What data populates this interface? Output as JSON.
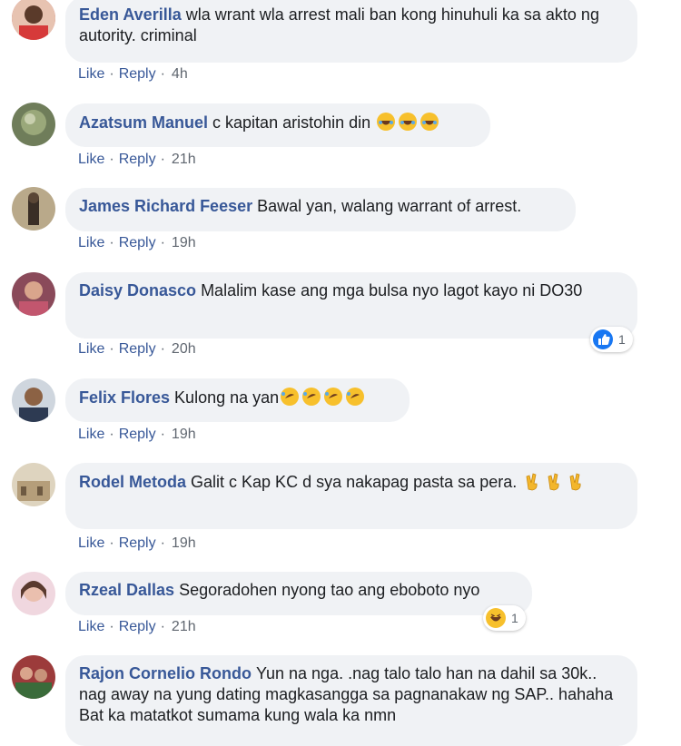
{
  "comments": [
    {
      "author": "Eden Averilla",
      "text": "wla wrant wla arrest mali ban kong hinuhuli ka sa akto ng autority. criminal",
      "suffix": "",
      "time": "4h"
    },
    {
      "author": "Azatsum Manuel",
      "text": "c kapitan aristohin din",
      "suffix": "",
      "time": "21h"
    },
    {
      "author": "James Richard Feeser",
      "text": "Bawal yan, walang warrant of arrest.",
      "suffix": "",
      "time": "19h"
    },
    {
      "author": "Daisy Donasco",
      "text": "Malalim kase ang mga bulsa nyo lagot kayo ni DO30",
      "suffix": "",
      "time": "20h",
      "reaction_count": "1"
    },
    {
      "author": "Felix Flores",
      "text": "Kulong na yan",
      "suffix": "",
      "time": "19h"
    },
    {
      "author": "Rodel Metoda",
      "text": "Galit c Kap KC d sya nakapag pasta sa pera.",
      "suffix": "",
      "time": "19h"
    },
    {
      "author": "Rzeal Dallas",
      "text": "Segoradohen nyong tao ang eboboto nyo",
      "suffix": "",
      "time": "21h",
      "reaction_count": "1"
    },
    {
      "author": "Rajon Cornelio Rondo",
      "text": "Yun na nga. .nag talo talo han na dahil sa 30k.. nag away na yung dating magkasangga sa pagnanakaw ng SAP.. hahaha Bat ka matatkot sumama kung wala ka nmn",
      "suffix": "",
      "time": ""
    }
  ],
  "actions": {
    "like": "Like",
    "reply": "Reply",
    "sep": "·"
  },
  "colors": {
    "bubble": "#f0f2f5",
    "name": "#385898",
    "meta": "#606770"
  }
}
